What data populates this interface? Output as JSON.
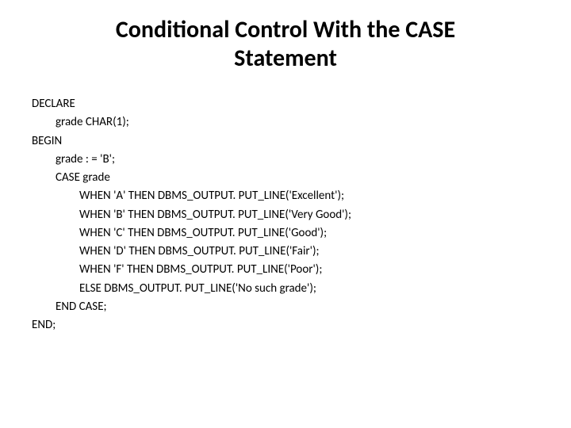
{
  "title": "Conditional Control With the CASE Statement",
  "code": {
    "l01": "DECLARE",
    "l02": "grade CHAR(1);",
    "l03": "BEGIN",
    "l04": "grade : = 'B';",
    "l05": "CASE grade",
    "l06": "WHEN 'A' THEN DBMS_OUTPUT. PUT_LINE('Excellent');",
    "l07": "WHEN 'B' THEN DBMS_OUTPUT. PUT_LINE('Very Good');",
    "l08": "WHEN 'C' THEN DBMS_OUTPUT. PUT_LINE('Good');",
    "l09": "WHEN 'D' THEN DBMS_OUTPUT. PUT_LINE('Fair');",
    "l10": "WHEN 'F' THEN DBMS_OUTPUT. PUT_LINE('Poor');",
    "l11": "ELSE   DBMS_OUTPUT. PUT_LINE('No such grade');",
    "l12": "END CASE;",
    "l13": "END;"
  }
}
